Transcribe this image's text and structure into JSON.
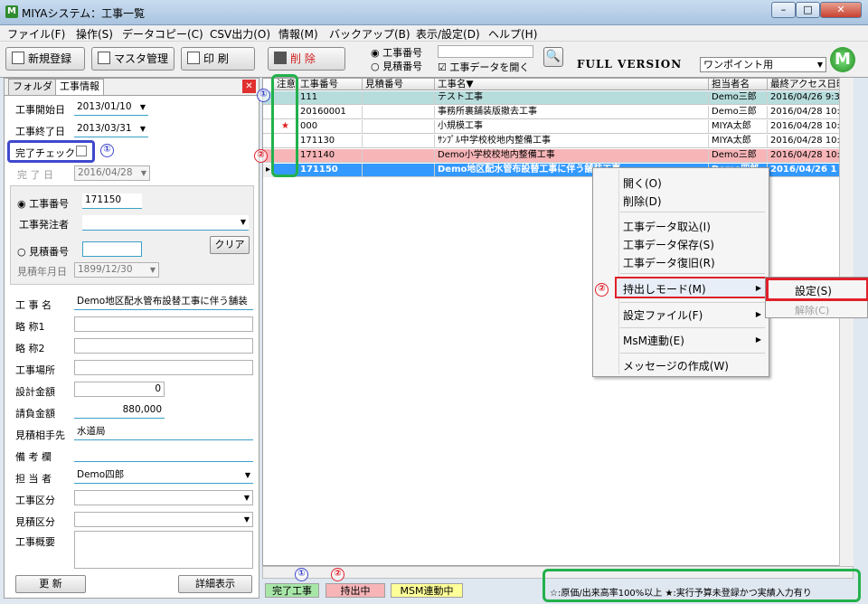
{
  "window": {
    "title": "MIYAシステム：工事一覧",
    "min": "–",
    "max": "□",
    "close": "✕",
    "app_icon": "M"
  },
  "menu": [
    "ファイル(F)",
    "操作(S)",
    "データコピー(C)",
    "CSV出力(O)",
    "情報(M)",
    "バックアップ(B)",
    "表示/設定(D)",
    "ヘルプ(H)"
  ],
  "toolbar": {
    "new": "新規登録",
    "master": "マスタ管理",
    "print": "印 刷",
    "delete": "削 除",
    "radio1": "工事番号",
    "radio2": "見積番号",
    "checkbox": "工事データを開く",
    "full_version": "FULL VERSION",
    "onepoint": "ワンポイント用",
    "logo": "M"
  },
  "tabs": [
    "フォルダ",
    "工事情報"
  ],
  "form": {
    "start_label": "工事開始日",
    "start": "2013/01/10",
    "end_label": "工事終了日",
    "end": "2013/03/31",
    "complete_check": "完了チェック",
    "complete_label": "完 了 日",
    "complete_date": "2016/04/28",
    "kouji_no_label": "工事番号",
    "kouji_no": "171150",
    "orderer_label": "工事発注者",
    "mitsumori_no_label": "見積番号",
    "clear": "クリア",
    "mitsumori_date_label": "見積年月日",
    "mitsumori_date": "1899/12/30",
    "name_label": "工 事 名",
    "name": "Demo地区配水管布設替工事に伴う舗装",
    "abbr1_label": "略 称1",
    "abbr2_label": "略 称2",
    "site_label": "工事場所",
    "design_label": "設計金額",
    "design": "0",
    "contract_label": "請負金額",
    "contract": "880,000",
    "partner_label": "見積相手先",
    "partner": "水道局",
    "note_label": "備 考 欄",
    "staff_label": "担 当 者",
    "staff": "Demo四郎",
    "kubun_label": "工事区分",
    "mkubun_label": "見積区分",
    "summary_label": "工事概要",
    "update": "更 新",
    "detail": "詳細表示"
  },
  "grid": {
    "headers": [
      "注意",
      "工事番号",
      "見積番号",
      "工事名▼",
      "担当者名",
      "最終アクセス日時"
    ],
    "rows": [
      [
        "",
        "111",
        "",
        "テスト工事",
        "Demo三郎",
        "2016/04/26 9:39"
      ],
      [
        "",
        "20160001",
        "",
        "事務所裏舗装版撤去工事",
        "Demo三郎",
        "2016/04/28 10:1"
      ],
      [
        "★",
        "000",
        "",
        "小規模工事",
        "MIYA太郎",
        "2016/04/28 10:1"
      ],
      [
        "",
        "171130",
        "",
        "ｻﾝﾌﾟﾙ中学校校地内整備工事",
        "MIYA太郎",
        "2016/04/28 10:0"
      ],
      [
        "",
        "171140",
        "",
        "Demo小学校校地内整備工事",
        "Demo三郎",
        "2016/04/28 10:2"
      ],
      [
        "",
        "171150",
        "",
        "Demo地区配水管布設替工事に伴う舗装工事",
        "Demo四郎",
        "2016/04/26 1"
      ]
    ]
  },
  "context_menu": [
    "開く(O)",
    "削除(D)",
    "工事データ取込(I)",
    "工事データ保存(S)",
    "工事データ復旧(R)",
    "持出しモード(M)",
    "設定ファイル(F)",
    "MsM連動(E)",
    "メッセージの作成(W)"
  ],
  "submenu": [
    "設定(S)",
    "解除(C)"
  ],
  "status": {
    "complete": "完了工事",
    "takeout": "持出中",
    "msm": "MSM連動中",
    "legend": "☆:原価/出来高率100%以上 ★:実行予算未登録かつ実績入力有り"
  },
  "annotations": {
    "one": "①",
    "two": "②"
  },
  "colors": {
    "row_teal": "#b7dcdc",
    "row_pink": "#f7b5b8",
    "row_selected": "#3399ff",
    "status_green": "#a8e6a8",
    "status_pink": "#f7b5b8",
    "status_yellow": "#ffff99"
  }
}
